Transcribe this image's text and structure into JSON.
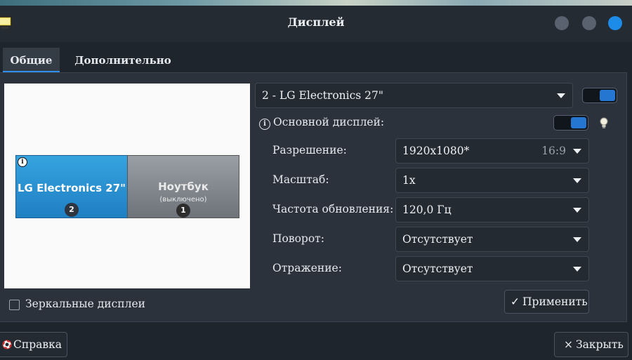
{
  "window": {
    "title": "Дисплей",
    "accent_color": "#2f8ff0",
    "close_button_color": "#1d8ce8"
  },
  "tabs": [
    {
      "label": "Общие",
      "active": true
    },
    {
      "label": "Дополнительно",
      "active": false
    }
  ],
  "preview": {
    "monitors": [
      {
        "name": "LG Electronics 27\"",
        "number": "2",
        "state": "selected",
        "color": "#2a8fd3"
      },
      {
        "name": "Ноутбук",
        "subtitle": "(выключено)",
        "number": "1",
        "state": "off",
        "color": "#85898f"
      }
    ],
    "info_glyph": "i"
  },
  "mirror": {
    "label": "Зеркальные дисплеи",
    "checked": false
  },
  "display_select": {
    "value": "2 - LG Electronics 27\"",
    "enabled": true
  },
  "primary": {
    "info_glyph": "i",
    "label": "Основной дисплей:",
    "enabled": true,
    "identify_icon": "bulb-icon"
  },
  "settings": [
    {
      "label": "Разрешение:",
      "value": "1920x1080*",
      "aspect": "16:9"
    },
    {
      "label": "Масштаб:",
      "value": "1x"
    },
    {
      "label": "Частота обновления:",
      "value": "120,0 Гц"
    },
    {
      "label": "Поворот:",
      "value": "Отсутствует"
    },
    {
      "label": "Отражение:",
      "value": "Отсутствует"
    }
  ],
  "buttons": {
    "apply": {
      "icon": "check-icon",
      "glyph": "✓",
      "label": "Применить"
    },
    "help": {
      "icon": "lifebuoy-icon",
      "label": "Справка"
    },
    "close": {
      "icon": "close-icon",
      "glyph": "×",
      "label": "Закрыть"
    }
  }
}
